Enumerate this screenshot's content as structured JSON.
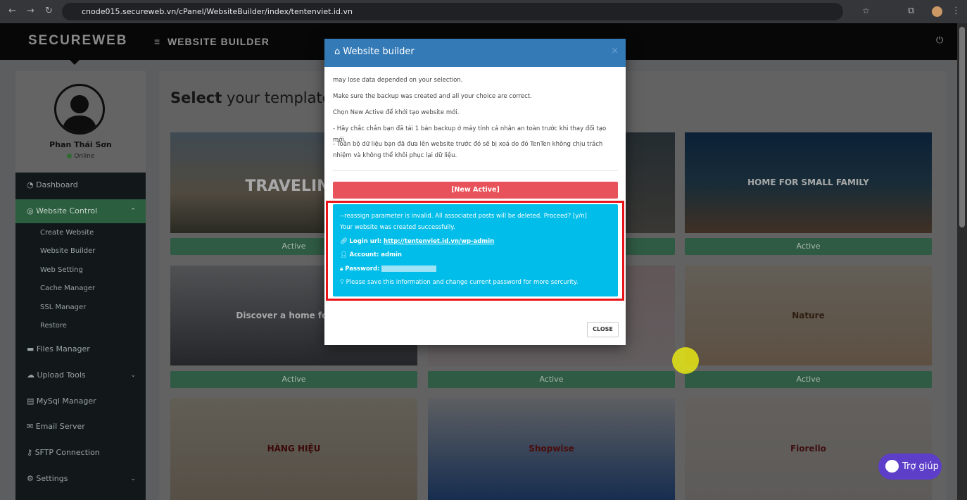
{
  "browser": {
    "url": "cnode015.secureweb.vn/cPanel/WebsiteBuilder/index/tentenviet.id.vn"
  },
  "header": {
    "logo": "SECUREWEB",
    "title": "WEBSITE BUILDER"
  },
  "profile": {
    "name": "Phan Thái Sơn",
    "status": "Online"
  },
  "sidebar": {
    "items": [
      {
        "label": "Dashboard"
      },
      {
        "label": "Website Control"
      },
      {
        "label": "Files Manager"
      },
      {
        "label": "Upload Tools"
      },
      {
        "label": "MySql Manager"
      },
      {
        "label": "Email Server"
      },
      {
        "label": "SFTP Connection"
      },
      {
        "label": "Settings"
      }
    ],
    "subitems": [
      "Create Website",
      "Website Builder",
      "Web Setting",
      "Cache Manager",
      "SSL Manager",
      "Restore"
    ]
  },
  "main": {
    "title_bold": "Select",
    "title_rest": " your template",
    "active_label": "Active",
    "templates": [
      {
        "caption": "TRAVELING"
      },
      {
        "caption": ""
      },
      {
        "caption": "HOME FOR SMALL FAMILY"
      },
      {
        "caption": "Discover a home for eve"
      },
      {
        "caption": ""
      },
      {
        "caption": "Nature"
      },
      {
        "caption": "HÀNG HIỆU"
      },
      {
        "caption": "Shopwise"
      },
      {
        "caption": "Fiorello"
      }
    ]
  },
  "modal": {
    "title": "Website builder",
    "paragraphs": [
      "may lose data depended on your selection.",
      "Make sure the backup was created and all your choice are correct.",
      "Chọn New Active để khởi tạo website mới.",
      "- Hãy chắc chắn bạn đã tải 1 bản backup ở máy tính cá nhân an toàn trước khi thay đổi tạo mới.",
      "- Toàn bộ dữ liệu bạn đã đưa lên website trước đó sẽ bị xoá do đó TenTen không chịu trách nhiệm và không thể khôi phục lại dữ liệu."
    ],
    "new_active": "[New Active]",
    "info": {
      "line1": "--reassign parameter is invalid. All associated posts will be deleted. Proceed? [y/n]",
      "line2": "Your website was created successfully.",
      "login_label": "Login url:",
      "login_url": "http://tentenviet.id.vn/wp-admin",
      "account_label": "Account:",
      "account": "admin",
      "password_label": "Password:",
      "note": "Please save this information and change current password for more sercurity."
    },
    "close": "CLOSE"
  },
  "help": {
    "label": "Trợ giúp"
  },
  "colors": {
    "modal_header": "#337ab7",
    "new_active": "#e8525a",
    "info_box": "#00bde9",
    "highlight_border": "#e8141a",
    "help_button": "#5c3ec9",
    "active_button": "#5cb88a"
  }
}
